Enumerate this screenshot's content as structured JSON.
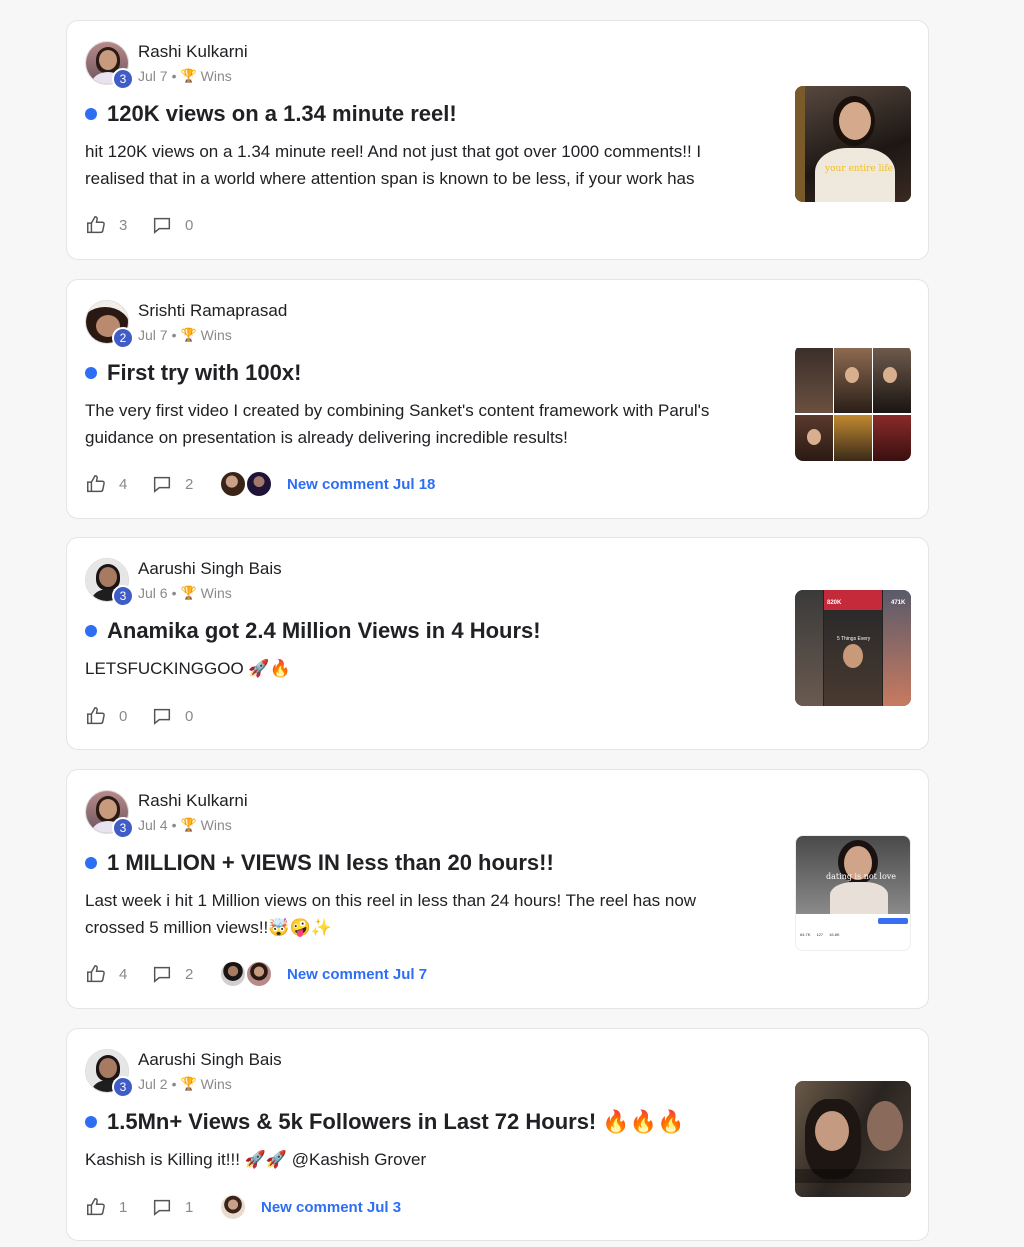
{
  "posts": [
    {
      "author": "Rashi Kulkarni",
      "level": "3",
      "date": "Jul 7",
      "category": "Wins",
      "title": "120K views on a 1.34 minute reel!",
      "body_lines": [
        "hit 120K views on a 1.34 minute reel! And not just that got over 1000 comments!! I",
        "realised that in a world where attention span is known to be less, if your work has"
      ],
      "likes": "3",
      "comments": "0",
      "new_comment": "",
      "thumb_caption": "your entire life"
    },
    {
      "author": "Srishti Ramaprasad",
      "level": "2",
      "date": "Jul 7",
      "category": "Wins",
      "title": "First try with 100x!",
      "body_lines": [
        "The very first video I created by combining Sanket's content framework with Parul's",
        "guidance on presentation is already delivering incredible results!"
      ],
      "likes": "4",
      "comments": "2",
      "new_comment": "New comment Jul 18"
    },
    {
      "author": "Aarushi Singh Bais",
      "level": "3",
      "date": "Jul 6",
      "category": "Wins",
      "title": "Anamika got 2.4 Million Views in 4 Hours!",
      "body_lines": [
        "LETSFUCKINGGOO 🚀🔥"
      ],
      "likes": "0",
      "comments": "0",
      "new_comment": "",
      "thumb_tags": [
        "820K",
        "471K",
        "5 Things Every"
      ]
    },
    {
      "author": "Rashi Kulkarni",
      "level": "3",
      "date": "Jul 4",
      "category": "Wins",
      "title": "1 MILLION + VIEWS IN less than 20 hours!!",
      "body_lines": [
        "Last week i hit 1 Million views on this reel in less than 24 hours! The reel has now",
        "crossed 5 million views!!🤯🤪✨"
      ],
      "likes": "4",
      "comments": "2",
      "new_comment": "New comment Jul 7",
      "thumb_caption": "dating is not love",
      "thumb_stats": [
        "64.7K",
        "127",
        "16.6K"
      ]
    },
    {
      "author": "Aarushi Singh Bais",
      "level": "3",
      "date": "Jul 2",
      "category": "Wins",
      "title": "1.5Mn+ Views & 5k Followers in Last 72 Hours! 🔥🔥🔥",
      "body_lines": [
        "Kashish is Killing it!!! 🚀🚀 @Kashish Grover"
      ],
      "likes": "1",
      "comments": "1",
      "new_comment": "New comment Jul 3"
    }
  ],
  "colors": {
    "accent": "#2d6ef5",
    "level_badge": "#3f5cc7"
  },
  "icons": {
    "like": "thumbs-up-icon",
    "comment": "comment-bubble-icon",
    "category": "trophy-icon"
  }
}
